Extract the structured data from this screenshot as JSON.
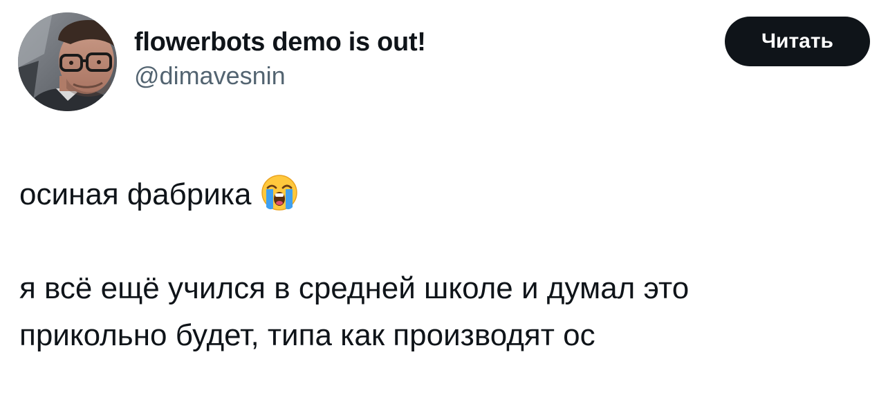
{
  "author": {
    "display_name": "flowerbots demo is out!",
    "handle": "@dimavesnin"
  },
  "actions": {
    "follow_label": "Читать"
  },
  "post": {
    "paragraph_1": {
      "text": "осиная фабрика",
      "emoji": "loudly-crying-face-icon"
    },
    "paragraph_2": {
      "lines": [
        "я всё ещё учился в средней школе и думал это",
        "прикольно будет, типа как производят ос"
      ]
    }
  },
  "colors": {
    "text_primary": "#0f1419",
    "text_secondary": "#536471",
    "button_background": "#0f1419",
    "button_text": "#ffffff",
    "background": "#ffffff"
  }
}
